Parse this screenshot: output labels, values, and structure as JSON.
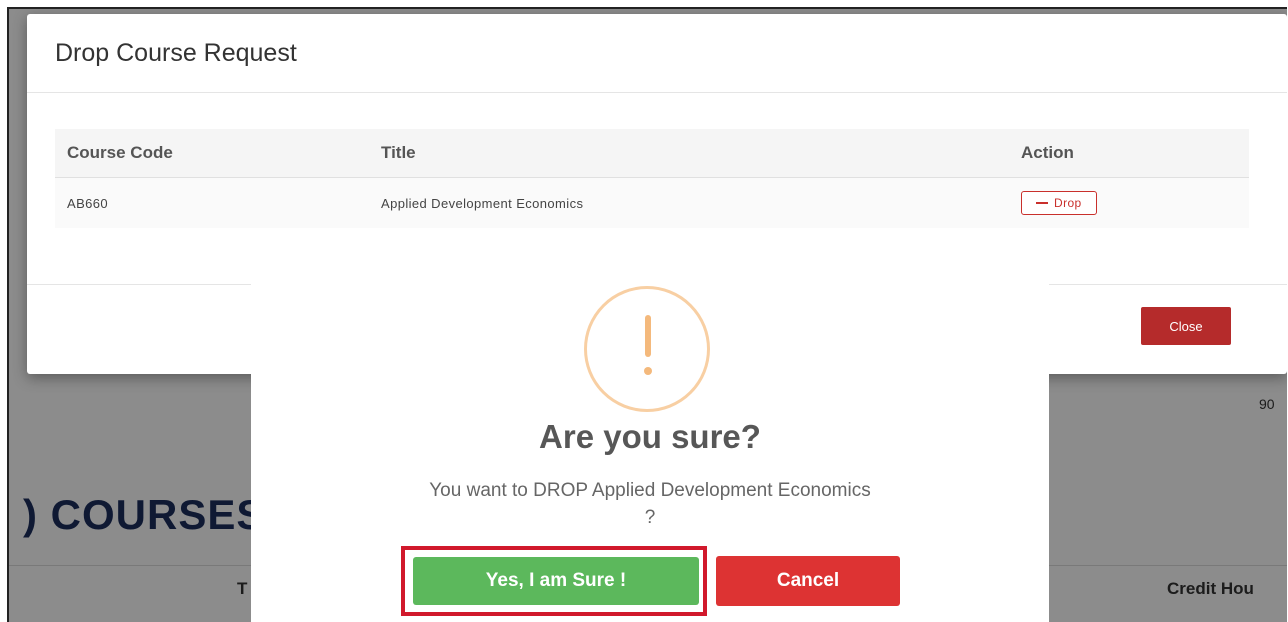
{
  "background": {
    "heading": ") COURSES",
    "amount_partial": "90",
    "table_col_title_partial": "T",
    "table_col_credit_partial": "Credit Hou"
  },
  "drop_modal": {
    "title": "Drop Course Request",
    "columns": [
      "Course Code",
      "Title",
      "Action"
    ],
    "rows": [
      {
        "code": "AB660",
        "title": "Applied Development Economics",
        "action_label": "Drop",
        "action_icon": "minus-icon"
      }
    ],
    "close_label": "Close"
  },
  "confirm_dialog": {
    "icon": "warning-icon",
    "title": "Are you sure?",
    "message_line1": "You want to DROP Applied Development Economics",
    "message_line2": "?",
    "confirm_label": "Yes, I am Sure !",
    "cancel_label": "Cancel"
  },
  "colors": {
    "confirm": "#5cb85c",
    "cancel": "#dd3333",
    "close": "#b52b2b",
    "highlight": "#d1192c",
    "warning": "#f8cfa3"
  }
}
